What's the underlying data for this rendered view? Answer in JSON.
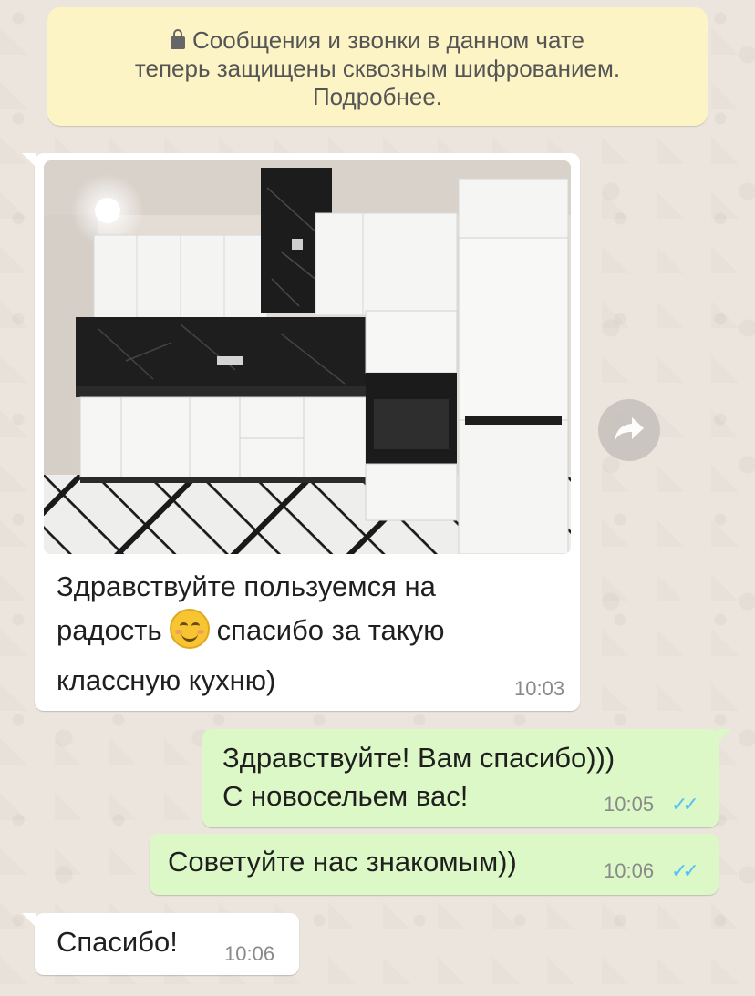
{
  "encryption_notice": {
    "icon": "lock-icon",
    "line1": "Сообщения и звонки в данном чате",
    "line2": "теперь защищены сквозным шифрованием.",
    "line3": "Подробнее."
  },
  "messages": [
    {
      "direction": "incoming",
      "has_image": true,
      "line1": "Здравствуйте пользуемся на",
      "line2_before": "радость",
      "line2_emoji": "smiling-face-emoji",
      "line2_after": "спасибо за такую",
      "line3": "классную кухню)",
      "time": "10:03"
    },
    {
      "direction": "outgoing",
      "line1": "Здравствуйте! Вам спасибо)))",
      "line2": "С новосельем вас!",
      "time": "10:05",
      "status": "read"
    },
    {
      "direction": "outgoing",
      "line1": "Советуйте нас знакомым))",
      "time": "10:06",
      "status": "read"
    },
    {
      "direction": "incoming",
      "line1": "Спасибо!",
      "time": "10:06"
    }
  ],
  "colors": {
    "chat_background": "#ece5dd",
    "notice_background": "#fcf4c4",
    "incoming_bubble": "#ffffff",
    "outgoing_bubble": "#dcf8c6",
    "read_ticks": "#4fc3f7"
  },
  "forward_button": {
    "icon": "forward-arrow-icon"
  }
}
